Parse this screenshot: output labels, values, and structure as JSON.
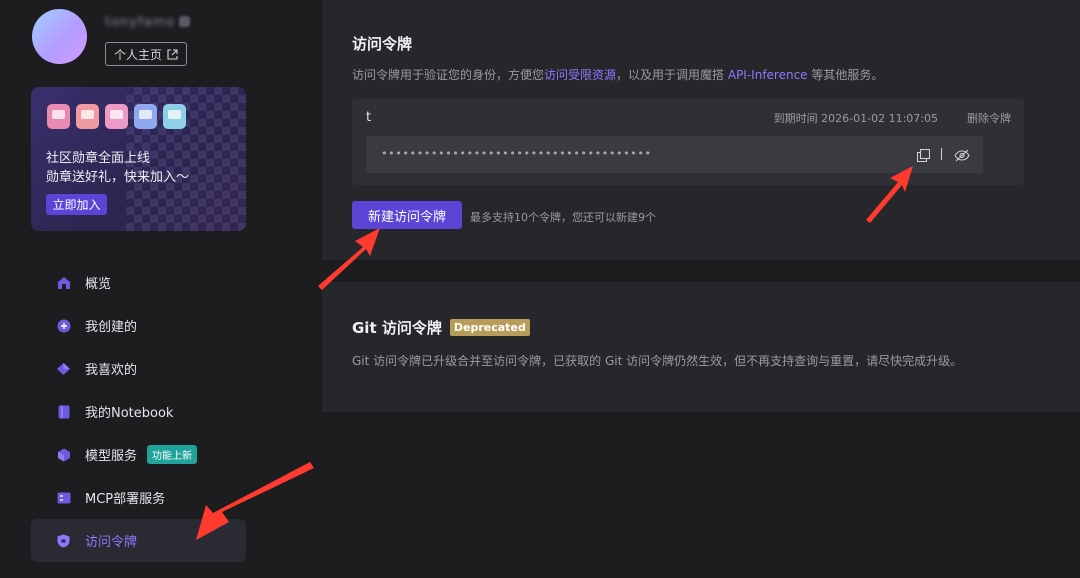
{
  "colors": {
    "accent": "#5b45d6",
    "accent_text": "#8e78ff",
    "arrow": "#ff3b30",
    "new_tag": "#1fa39a",
    "deprecated": "#b79c5a"
  },
  "profile": {
    "username": "tonyfamo",
    "homepage_label": "个人主页"
  },
  "promo": {
    "line1": "社区勋章全面上线",
    "line2": "勋章送好礼，快来加入～",
    "join_label": "立即加入"
  },
  "nav": {
    "items": [
      {
        "label": "概览",
        "icon": "home-icon"
      },
      {
        "label": "我创建的",
        "icon": "plus-circle-icon"
      },
      {
        "label": "我喜欢的",
        "icon": "diamond-icon"
      },
      {
        "label": "我的Notebook",
        "icon": "notebook-icon"
      },
      {
        "label": "模型服务",
        "icon": "cube-icon",
        "tag": "功能上新"
      },
      {
        "label": "MCP部署服务",
        "icon": "server-icon"
      },
      {
        "label": "访问令牌",
        "icon": "shield-icon",
        "active": true
      }
    ]
  },
  "access_token": {
    "title": "访问令牌",
    "desc_before": "访问令牌用于验证您的身份，方便您",
    "desc_link1": "访问受限资源",
    "desc_middle": "，以及用于调用魔搭 ",
    "desc_link2": "API-Inference",
    "desc_after": " 等其他服务。",
    "token": {
      "name": "t",
      "expiry": "到期时间 2026-01-02 11:07:05",
      "delete_label": "删除令牌",
      "masked_value": "••••••••••••••••••••••••••••••••••••••",
      "copy_icon": "copy-icon",
      "visibility_icon": "eye-off-icon"
    },
    "create_label": "新建访问令牌",
    "limit_note": "最多支持10个令牌，您还可以新建9个"
  },
  "git_token": {
    "title": "Git 访问令牌",
    "badge": "Deprecated",
    "desc": "Git 访问令牌已升级合并至访问令牌，已获取的 Git 访问令牌仍然生效，但不再支持查询与重置，请尽快完成升级。"
  }
}
